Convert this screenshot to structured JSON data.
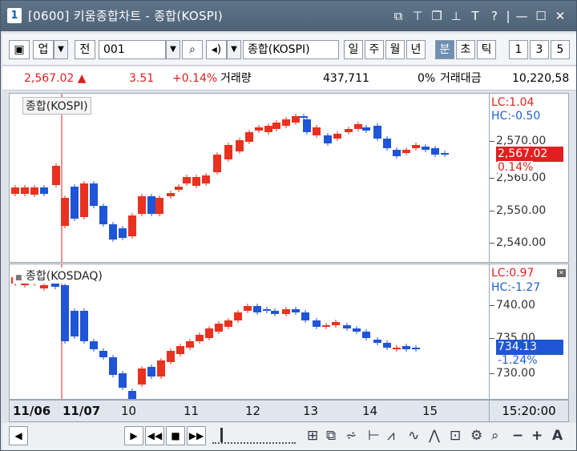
{
  "window": {
    "number": "1",
    "title": "[0600] 키움종합차트 - 종합(KOSPI)",
    "icons": [
      "restore-layout-icon",
      "pin-top-icon",
      "window-copy-icon",
      "push-pin-icon",
      "font-icon",
      "help-icon",
      "minimize-icon",
      "maximize-icon",
      "close-icon"
    ]
  },
  "toolbar": {
    "panel_icon": "panel-toggle-icon",
    "market": "업",
    "all_label": "전",
    "code": "001",
    "search_icon": "search-icon",
    "speaker_icon": "speaker-icon",
    "name": "종합(KOSPI)",
    "periods": [
      "일",
      "주",
      "월",
      "년",
      "분",
      "초",
      "틱"
    ],
    "selected_period": "분",
    "intervals": [
      "1",
      "3",
      "5"
    ]
  },
  "price": {
    "current": "2,567.02 ▲",
    "change": "3.51",
    "change_rate": "+0.14%",
    "volume_label": "거래량",
    "volume": "437,711",
    "volume_rate": "0%",
    "amount_label": "거래대금",
    "amount": "10,220,58"
  },
  "kospi_pane": {
    "label": "종합(KOSPI)",
    "lc": "LC:1.04",
    "hc": "HC:-0.50",
    "ticks": [
      "2,570.00",
      "2,560.00",
      "2,550.00",
      "2,540.00"
    ],
    "price_tag": "2,567.02",
    "pct_tag": "0.14%"
  },
  "kosdaq_pane": {
    "label": "종합(KOSDAQ)",
    "lc": "LC:0.97",
    "hc": "HC:-1.27",
    "ticks": [
      "740.00",
      "735.00",
      "730.00"
    ],
    "price_tag": "734.13",
    "pct_tag": "-1.24%"
  },
  "xaxis": {
    "labels": [
      "11/06",
      "11/07",
      "10",
      "11",
      "12",
      "13",
      "14",
      "15"
    ],
    "time": "15:20:00"
  },
  "bottom": {
    "buttons": [
      "◀",
      "▶",
      "◀◀",
      "■",
      "▶▶"
    ],
    "tools": [
      "select-icon",
      "window-icon",
      "chart-type-icon",
      "cursor-icon",
      "trend-icon",
      "line-icon",
      "pattern-icon",
      "zoom-area-icon",
      "settings-icon",
      "zoom-icon",
      "minus-icon",
      "plus-icon",
      "text-icon"
    ]
  },
  "colors": {
    "up": "#e8321f",
    "down": "#1f55d6",
    "title_bar": "#566b80",
    "selected": "#6d8fb2"
  }
}
